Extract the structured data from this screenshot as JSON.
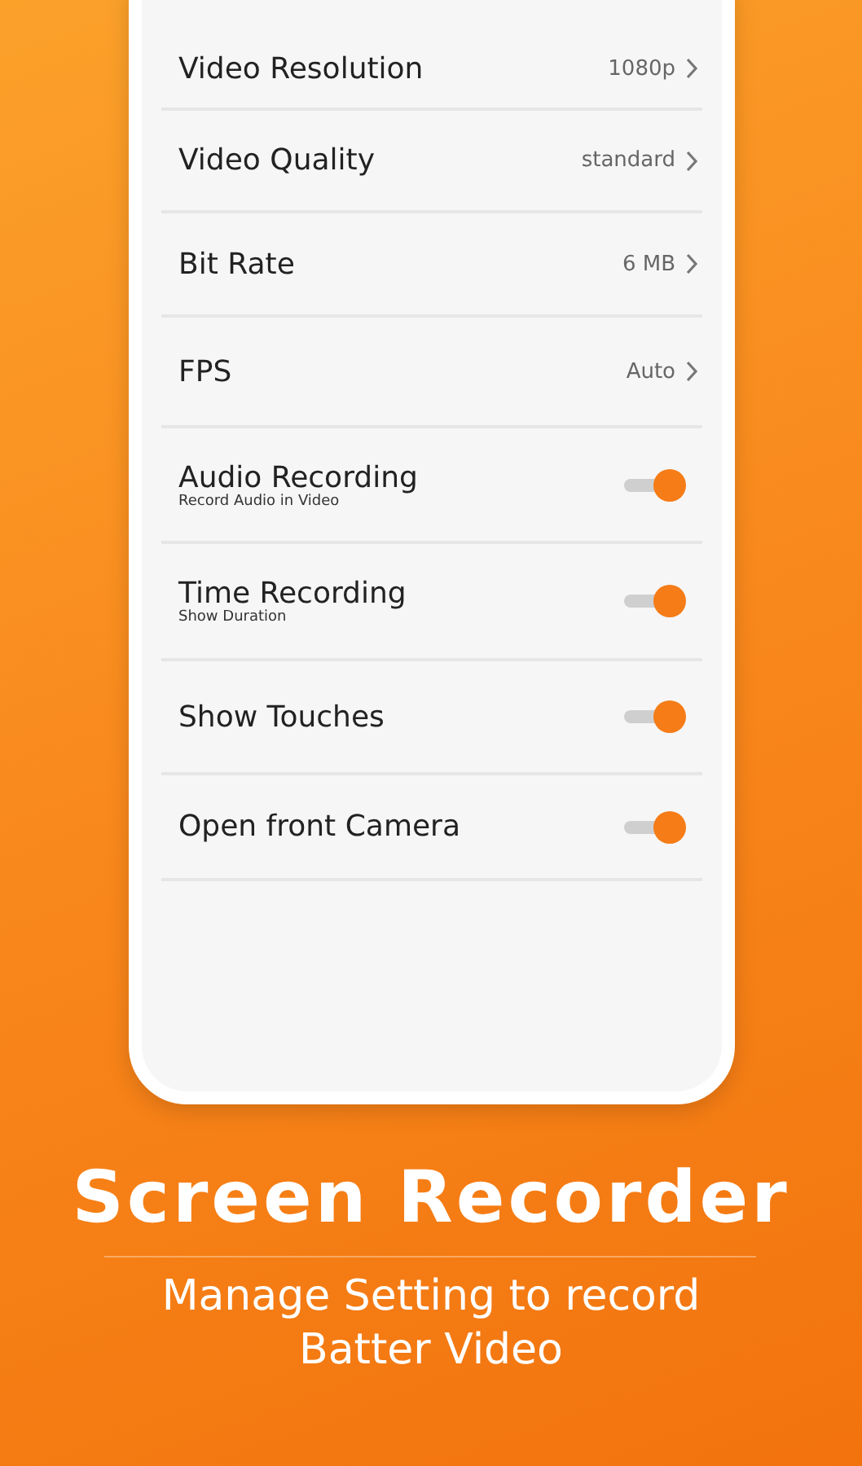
{
  "settings": [
    {
      "kind": "choice",
      "label": "Video Resolution",
      "value": "1080p"
    },
    {
      "kind": "choice",
      "label": "Video Quality",
      "value": "standard"
    },
    {
      "kind": "choice",
      "label": "Bit Rate",
      "value": "6 MB"
    },
    {
      "kind": "choice",
      "label": "FPS",
      "value": "Auto"
    },
    {
      "kind": "toggle",
      "label": "Audio Recording",
      "subtitle": "Record Audio in Video",
      "on": true
    },
    {
      "kind": "toggle",
      "label": "Time Recording",
      "subtitle": "Show Duration",
      "on": true
    },
    {
      "kind": "toggle",
      "label": "Show Touches",
      "on": true
    },
    {
      "kind": "toggle",
      "label": "Open front Camera",
      "on": true
    }
  ],
  "promo": {
    "title": "Screen Recorder",
    "subtitle": "Manage Setting to record Batter Video"
  }
}
